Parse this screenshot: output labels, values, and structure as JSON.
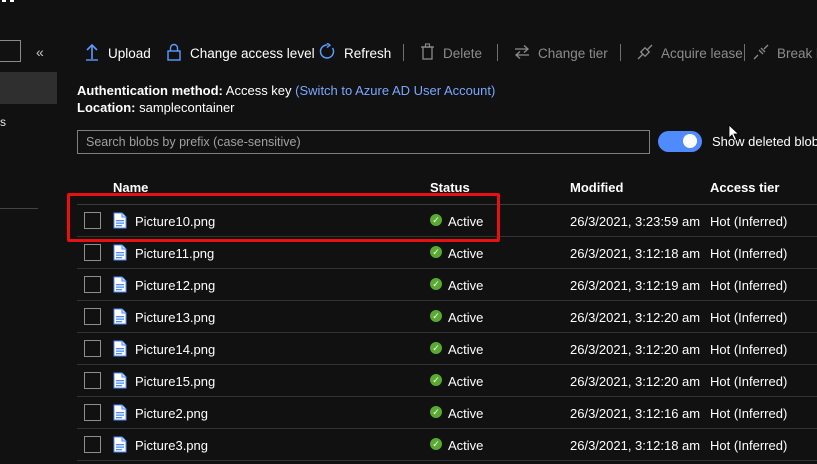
{
  "toolbar": {
    "upload": "Upload",
    "change_access": "Change access level",
    "refresh": "Refresh",
    "delete": "Delete",
    "change_tier": "Change tier",
    "acquire_lease": "Acquire lease",
    "break_lease": "Break l"
  },
  "info": {
    "auth_label": "Authentication method:",
    "auth_value": "Access key",
    "auth_link": "(Switch to Azure AD User Account)",
    "location_label": "Location:",
    "location_value": "samplecontainer"
  },
  "search": {
    "placeholder": "Search blobs by prefix (case-sensitive)"
  },
  "show_deleted": {
    "label": "Show deleted blob",
    "on": true
  },
  "sidebar": {
    "partial_text": "s"
  },
  "columns": {
    "name": "Name",
    "status": "Status",
    "modified": "Modified",
    "tier": "Access tier"
  },
  "rows": [
    {
      "name": "Picture10.png",
      "status": "Active",
      "modified": "26/3/2021, 3:23:59 am",
      "tier": "Hot (Inferred)"
    },
    {
      "name": "Picture11.png",
      "status": "Active",
      "modified": "26/3/2021, 3:12:18 am",
      "tier": "Hot (Inferred)"
    },
    {
      "name": "Picture12.png",
      "status": "Active",
      "modified": "26/3/2021, 3:12:19 am",
      "tier": "Hot (Inferred)"
    },
    {
      "name": "Picture13.png",
      "status": "Active",
      "modified": "26/3/2021, 3:12:20 am",
      "tier": "Hot (Inferred)"
    },
    {
      "name": "Picture14.png",
      "status": "Active",
      "modified": "26/3/2021, 3:12:20 am",
      "tier": "Hot (Inferred)"
    },
    {
      "name": "Picture15.png",
      "status": "Active",
      "modified": "26/3/2021, 3:12:20 am",
      "tier": "Hot (Inferred)"
    },
    {
      "name": "Picture2.png",
      "status": "Active",
      "modified": "26/3/2021, 3:12:16 am",
      "tier": "Hot (Inferred)"
    },
    {
      "name": "Picture3.png",
      "status": "Active",
      "modified": "26/3/2021, 3:12:18 am",
      "tier": "Hot (Inferred)"
    }
  ],
  "colors": {
    "accent": "#4f8bff",
    "link": "#7aa7ff",
    "active": "#5aaa2f",
    "highlight": "#e81010"
  }
}
